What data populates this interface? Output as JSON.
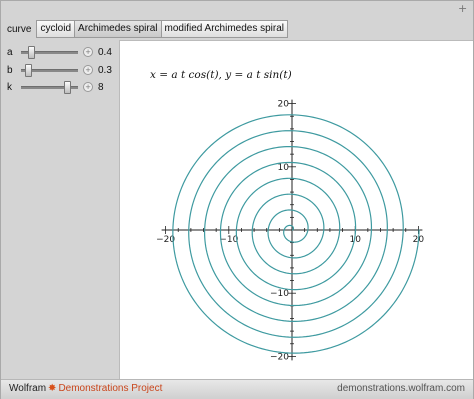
{
  "controls": {
    "curve_label": "curve",
    "curve_options": [
      {
        "label": "cycloid",
        "selected": false
      },
      {
        "label": "Archimedes spiral",
        "selected": true
      },
      {
        "label": "modified Archimedes spiral",
        "selected": false
      }
    ],
    "sliders": [
      {
        "name": "a",
        "value": "0.4",
        "position": 0.18
      },
      {
        "name": "b",
        "value": "0.3",
        "position": 0.12
      },
      {
        "name": "k",
        "value": "8",
        "position": 0.8
      }
    ]
  },
  "plot": {
    "formula": "x = a t cos(t), y = a t sin(t)",
    "stroke_color": "#3e9aa0"
  },
  "chart_data": {
    "type": "line",
    "title": "",
    "xlabel": "",
    "ylabel": "",
    "xlim": [
      -20,
      20
    ],
    "ylim": [
      -20,
      20
    ],
    "xticks": [
      "−20",
      "−10",
      "10",
      "20"
    ],
    "yticks": [
      "20",
      "10",
      "−10",
      "−20"
    ],
    "grid": false,
    "series": [
      {
        "curve": "x = a t cos(t), y = a t sin(t)",
        "a": 0.4,
        "t_range": [
          0,
          50.27
        ]
      }
    ]
  },
  "footer": {
    "brand_prefix": "Wolfram",
    "brand_suffix": "Demonstrations Project",
    "site": "demonstrations.wolfram.com"
  }
}
